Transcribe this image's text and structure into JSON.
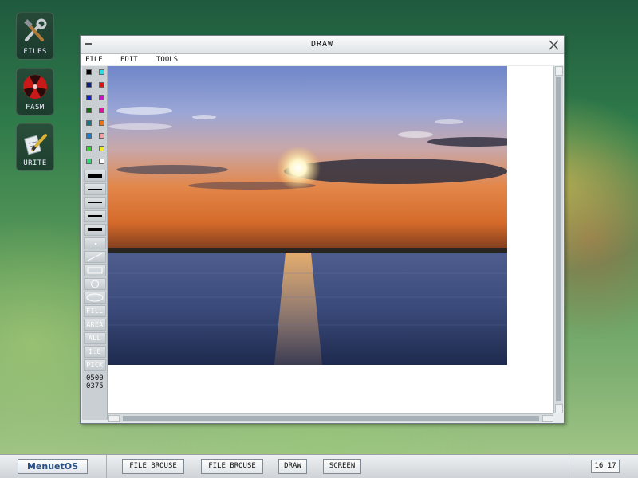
{
  "desktop": {
    "icons": [
      {
        "label": "FILES"
      },
      {
        "label": "FASM"
      },
      {
        "label": "URITE"
      }
    ]
  },
  "window": {
    "title": "DRAW",
    "menu": {
      "file": "FILE",
      "edit": "EDIT",
      "tools": "TOOLS"
    },
    "palette": [
      "#000000",
      "#22e0e8",
      "#0b1f8a",
      "#e01010",
      "#1020e0",
      "#d010d0",
      "#107010",
      "#e010a0",
      "#107a8a",
      "#f07010",
      "#1080e0",
      "#f0a0a0",
      "#20e020",
      "#f0f010",
      "#20e070",
      "#ffffff"
    ],
    "tools": {
      "fill": "FILL",
      "area": "AREA",
      "all": "ALL",
      "zoom": "1:8",
      "pick": "PICK"
    },
    "image_size": {
      "width": "0500",
      "height": "0375"
    }
  },
  "taskbar": {
    "start_label": "MenuetOS",
    "items": [
      "FILE BROUSE",
      "FILE BROUSE",
      "DRAW",
      "SCREEN"
    ],
    "clock": "16 17"
  },
  "colors": {
    "window_bg": "#e8ecee",
    "toolbox_bg": "#c9cfd3",
    "brand_text": "#2a4f86"
  }
}
